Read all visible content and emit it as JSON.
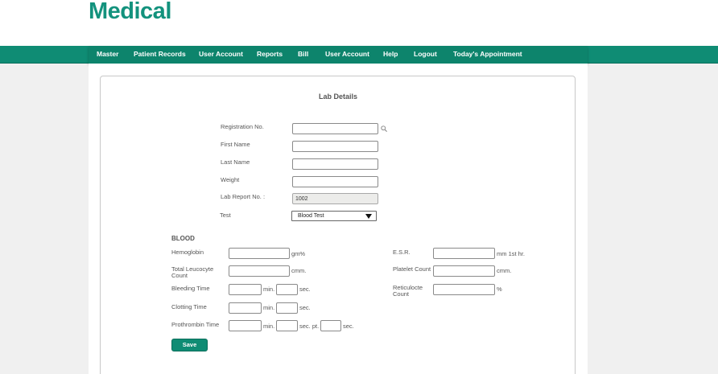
{
  "header": {
    "logo": "Medical"
  },
  "nav": {
    "items": [
      "Master",
      "Patient Records",
      "User Account",
      "Reports",
      "Bill",
      "User Account",
      "Help",
      "Logout",
      "Today's Appointment"
    ]
  },
  "form": {
    "title": "Lab Details",
    "registration_label": "Registration No.",
    "registration_value": "",
    "first_name_label": "First Name",
    "first_name_value": "",
    "last_name_label": "Last Name",
    "last_name_value": "",
    "weight_label": "Weight",
    "weight_value": "",
    "lab_report_label": "Lab Report No. :",
    "lab_report_value": "1002",
    "test_label": "Test",
    "test_selected": "Blood Test"
  },
  "blood": {
    "section_title": "BLOOD",
    "hemoglobin_label": "Hemoglobin",
    "hemoglobin_unit": "gm%",
    "tlc_label_line1": "Total Leucocyte",
    "tlc_label_line2": "Count",
    "tlc_unit": "cmm.",
    "bleeding_label": "Bleeding Time",
    "clotting_label": "Clotting Time",
    "prothrombin_label": "Prothrombin Time",
    "min_unit": "min.",
    "sec_unit": "sec.",
    "sec_pt_unit": "sec. pt.",
    "esr_label": "E.S.R.",
    "esr_unit": "mm 1st hr.",
    "platelet_label": "Platelet Count",
    "platelet_unit": "cmm.",
    "reticulocyte_label_line1": "Reticulocte",
    "reticulocyte_label_line2": "Count",
    "reticulocyte_unit": "%"
  },
  "actions": {
    "save_label": "Save"
  },
  "colors": {
    "brand": "#13927d",
    "nav": "#0f8c74"
  }
}
